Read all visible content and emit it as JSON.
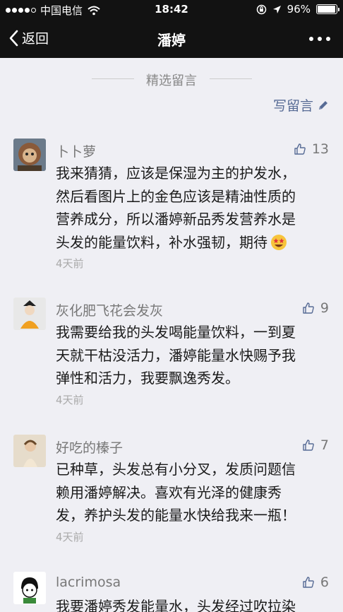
{
  "status_bar": {
    "carrier": "中国电信",
    "time": "18:42",
    "battery": "96%",
    "battery_level": 0.96
  },
  "nav": {
    "back_label": "返回",
    "title": "潘婷"
  },
  "section_title": "精选留言",
  "write_label": "写留言",
  "comments": [
    {
      "nickname": "卜卜萝",
      "likes": "13",
      "lines": [
        "我来猜猜，应该是保湿为主的护发水，",
        "然后看图片上的金色应该是精油性质的",
        "营养成分，所以潘婷新品秀发营养水是",
        "头发的能量饮料，补水强韧，期待"
      ],
      "emoji": "star-struck-emoji",
      "time": "4天前"
    },
    {
      "nickname": "灰化肥飞花会发灰",
      "likes": "9",
      "lines": [
        "我需要给我的头发喝能量饮料，一到夏",
        "天就干枯没活力，潘婷能量水快赐予我",
        "弹性和活力，我要飘逸秀发。"
      ],
      "time": "4天前"
    },
    {
      "nickname": "好吃的榛子",
      "likes": "7",
      "lines": [
        "已种草，头发总有小分叉，发质问题信",
        "赖用潘婷解决。喜欢有光泽的健康秀",
        "发，养护头发的能量水快给我来一瓶！"
      ],
      "time": "4天前"
    },
    {
      "nickname": "lacrimosa",
      "likes": "6",
      "lines": [
        "我要潘婷秀发能量水，头发经过吹拉染"
      ]
    }
  ]
}
